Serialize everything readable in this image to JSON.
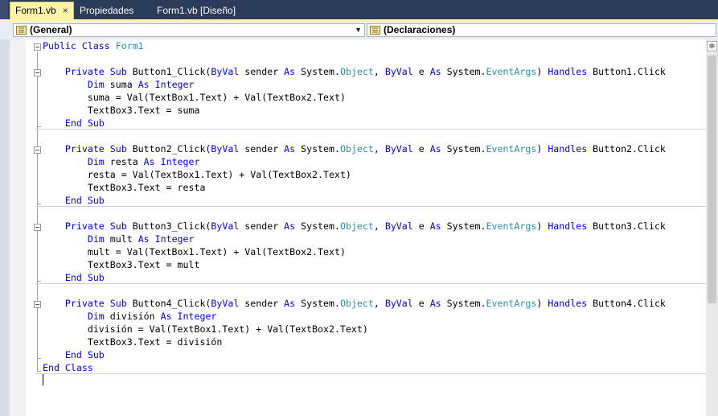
{
  "tabs": [
    {
      "label": "Form1.vb",
      "active": true
    },
    {
      "label": "Propiedades",
      "active": false
    },
    {
      "label": "Form1.vb [Diseño]",
      "active": false
    }
  ],
  "close_glyph": "×",
  "navbar": {
    "left_combo": "(General)",
    "right_combo": "(Declaraciones)",
    "arrow_glyph": "▼"
  },
  "code_lines": [
    [
      [
        "kw",
        "Public Class "
      ],
      [
        "ty",
        "Form1"
      ]
    ],
    [],
    [
      [
        "t",
        "    "
      ],
      [
        "kw",
        "Private Sub "
      ],
      [
        "t",
        "Button1_Click("
      ],
      [
        "kw",
        "ByVal"
      ],
      [
        "t",
        " sender "
      ],
      [
        "kw",
        "As"
      ],
      [
        "t",
        " System."
      ],
      [
        "ty",
        "Object"
      ],
      [
        "t",
        ", "
      ],
      [
        "kw",
        "ByVal"
      ],
      [
        "t",
        " e "
      ],
      [
        "kw",
        "As"
      ],
      [
        "t",
        " System."
      ],
      [
        "ty",
        "EventArgs"
      ],
      [
        "t",
        ") "
      ],
      [
        "kw",
        "Handles"
      ],
      [
        "t",
        " Button1.Click"
      ]
    ],
    [
      [
        "t",
        "        "
      ],
      [
        "kw",
        "Dim"
      ],
      [
        "t",
        " suma "
      ],
      [
        "kw",
        "As Integer"
      ]
    ],
    [
      [
        "t",
        "        suma = Val(TextBox1.Text) + Val(TextBox2.Text)"
      ]
    ],
    [
      [
        "t",
        "        TextBox3.Text = suma"
      ]
    ],
    [
      [
        "t",
        "    "
      ],
      [
        "kw",
        "End Sub"
      ]
    ],
    [],
    [
      [
        "t",
        "    "
      ],
      [
        "kw",
        "Private Sub "
      ],
      [
        "t",
        "Button2_Click("
      ],
      [
        "kw",
        "ByVal"
      ],
      [
        "t",
        " sender "
      ],
      [
        "kw",
        "As"
      ],
      [
        "t",
        " System."
      ],
      [
        "ty",
        "Object"
      ],
      [
        "t",
        ", "
      ],
      [
        "kw",
        "ByVal"
      ],
      [
        "t",
        " e "
      ],
      [
        "kw",
        "As"
      ],
      [
        "t",
        " System."
      ],
      [
        "ty",
        "EventArgs"
      ],
      [
        "t",
        ") "
      ],
      [
        "kw",
        "Handles"
      ],
      [
        "t",
        " Button2.Click"
      ]
    ],
    [
      [
        "t",
        "        "
      ],
      [
        "kw",
        "Dim"
      ],
      [
        "t",
        " resta "
      ],
      [
        "kw",
        "As Integer"
      ]
    ],
    [
      [
        "t",
        "        resta = Val(TextBox1.Text) + Val(TextBox2.Text)"
      ]
    ],
    [
      [
        "t",
        "        TextBox3.Text = resta"
      ]
    ],
    [
      [
        "t",
        "    "
      ],
      [
        "kw",
        "End Sub"
      ]
    ],
    [],
    [
      [
        "t",
        "    "
      ],
      [
        "kw",
        "Private Sub "
      ],
      [
        "t",
        "Button3_Click("
      ],
      [
        "kw",
        "ByVal"
      ],
      [
        "t",
        " sender "
      ],
      [
        "kw",
        "As"
      ],
      [
        "t",
        " System."
      ],
      [
        "ty",
        "Object"
      ],
      [
        "t",
        ", "
      ],
      [
        "kw",
        "ByVal"
      ],
      [
        "t",
        " e "
      ],
      [
        "kw",
        "As"
      ],
      [
        "t",
        " System."
      ],
      [
        "ty",
        "EventArgs"
      ],
      [
        "t",
        ") "
      ],
      [
        "kw",
        "Handles"
      ],
      [
        "t",
        " Button3.Click"
      ]
    ],
    [
      [
        "t",
        "        "
      ],
      [
        "kw",
        "Dim"
      ],
      [
        "t",
        " mult "
      ],
      [
        "kw",
        "As Integer"
      ]
    ],
    [
      [
        "t",
        "        mult = Val(TextBox1.Text) + Val(TextBox2.Text)"
      ]
    ],
    [
      [
        "t",
        "        TextBox3.Text = mult"
      ]
    ],
    [
      [
        "t",
        "    "
      ],
      [
        "kw",
        "End Sub"
      ]
    ],
    [],
    [
      [
        "t",
        "    "
      ],
      [
        "kw",
        "Private Sub "
      ],
      [
        "t",
        "Button4_Click("
      ],
      [
        "kw",
        "ByVal"
      ],
      [
        "t",
        " sender "
      ],
      [
        "kw",
        "As"
      ],
      [
        "t",
        " System."
      ],
      [
        "ty",
        "Object"
      ],
      [
        "t",
        ", "
      ],
      [
        "kw",
        "ByVal"
      ],
      [
        "t",
        " e "
      ],
      [
        "kw",
        "As"
      ],
      [
        "t",
        " System."
      ],
      [
        "ty",
        "EventArgs"
      ],
      [
        "t",
        ") "
      ],
      [
        "kw",
        "Handles"
      ],
      [
        "t",
        " Button4.Click"
      ]
    ],
    [
      [
        "t",
        "        "
      ],
      [
        "kw",
        "Dim"
      ],
      [
        "t",
        " división "
      ],
      [
        "kw",
        "As Integer"
      ]
    ],
    [
      [
        "t",
        "        división = Val(TextBox1.Text) + Val(TextBox2.Text)"
      ]
    ],
    [
      [
        "t",
        "        TextBox3.Text = división"
      ]
    ],
    [
      [
        "t",
        "    "
      ],
      [
        "kw",
        "End Sub"
      ]
    ],
    [
      [
        "kw",
        "End Class"
      ]
    ]
  ],
  "colors": {
    "keyword": "#0000ff",
    "type": "#2b91af",
    "active_tab": "#fff3a8",
    "tab_strip": "#2b3b5a"
  }
}
